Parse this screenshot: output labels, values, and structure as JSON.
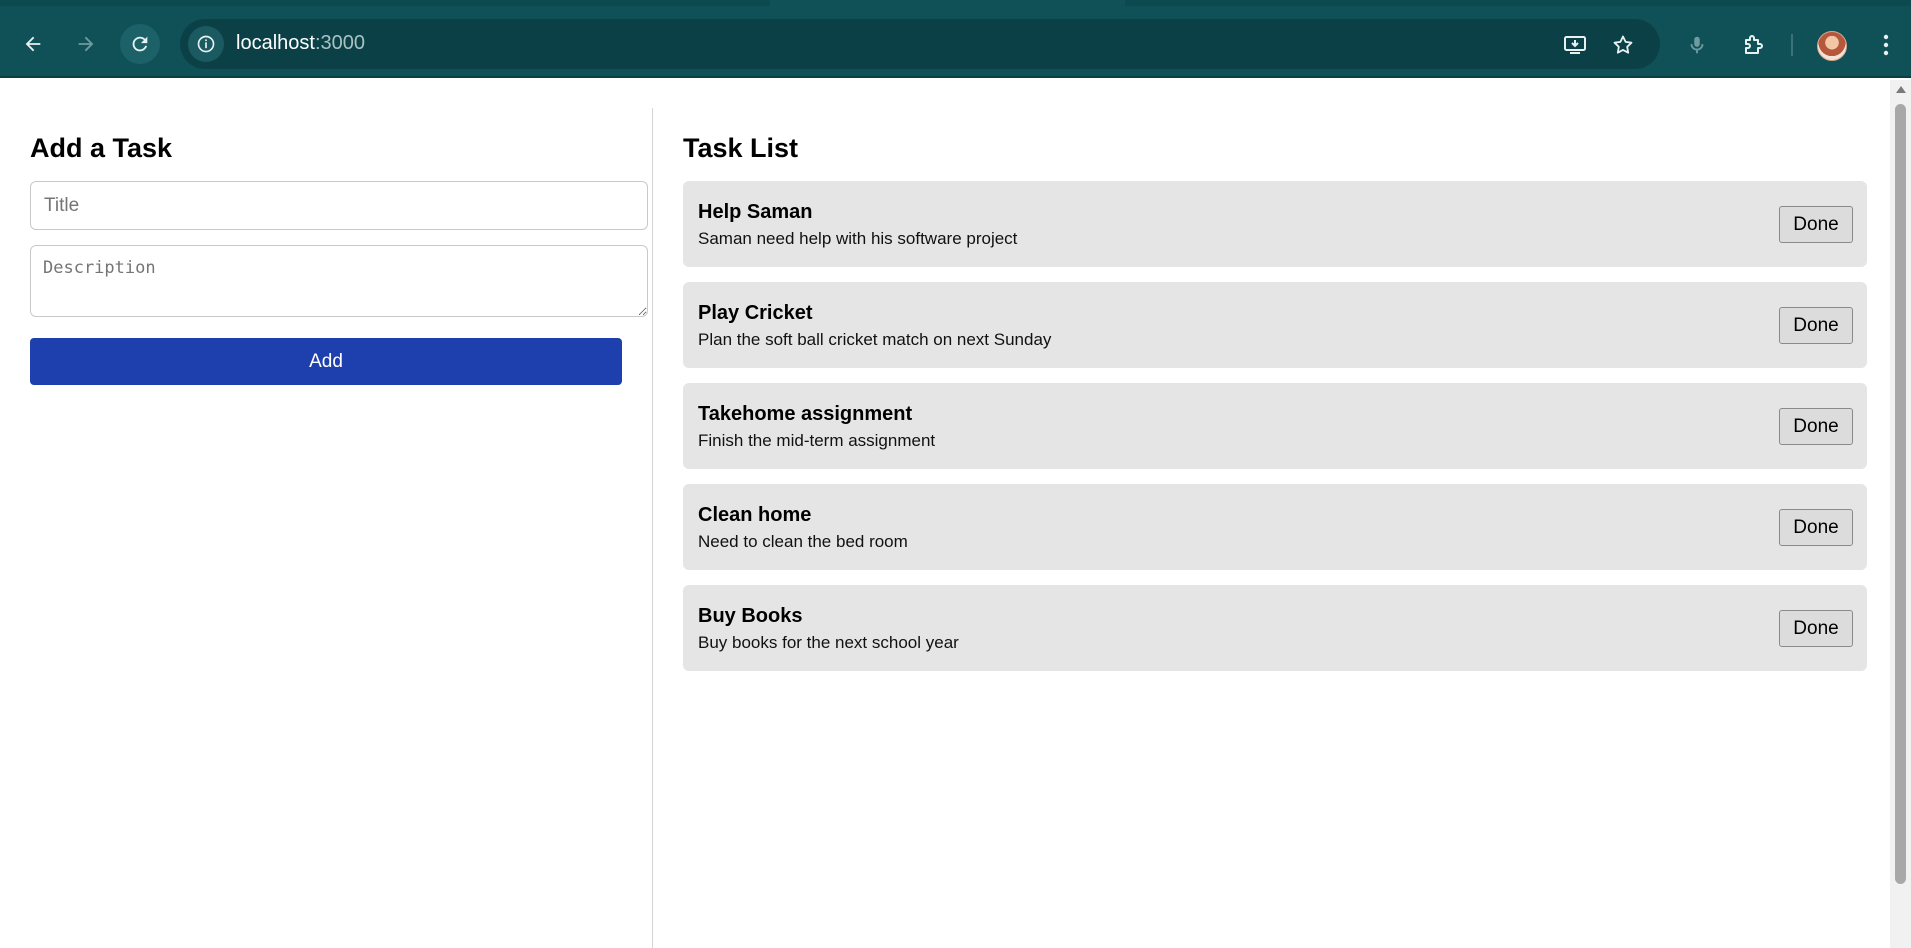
{
  "browser": {
    "url_host": "localhost",
    "url_port": ":3000",
    "icons": {
      "back": "arrow-left-icon",
      "forward": "arrow-right-icon",
      "reload": "reload-icon",
      "site_info": "info-icon",
      "install": "install-app-icon",
      "bookmark": "star-icon",
      "mic": "microphone-icon",
      "extensions": "puzzle-icon",
      "menu": "kebab-menu-icon"
    },
    "colors": {
      "toolbar": "#0f5157",
      "omnibox": "#0b4146"
    }
  },
  "add_task": {
    "heading": "Add a Task",
    "title_placeholder": "Title",
    "title_value": "",
    "description_placeholder": "Description",
    "description_value": "",
    "add_label": "Add",
    "add_color": "#1e3fae"
  },
  "task_list": {
    "heading": "Task List",
    "done_label": "Done",
    "tasks": [
      {
        "title": "Help Saman",
        "description": "Saman need help with his software project"
      },
      {
        "title": "Play Cricket",
        "description": "Plan the soft ball cricket match on next Sunday"
      },
      {
        "title": "Takehome assignment",
        "description": "Finish the mid-term assignment"
      },
      {
        "title": "Clean home",
        "description": "Need to clean the bed room"
      },
      {
        "title": "Buy Books",
        "description": "Buy books for the next school year"
      }
    ]
  }
}
